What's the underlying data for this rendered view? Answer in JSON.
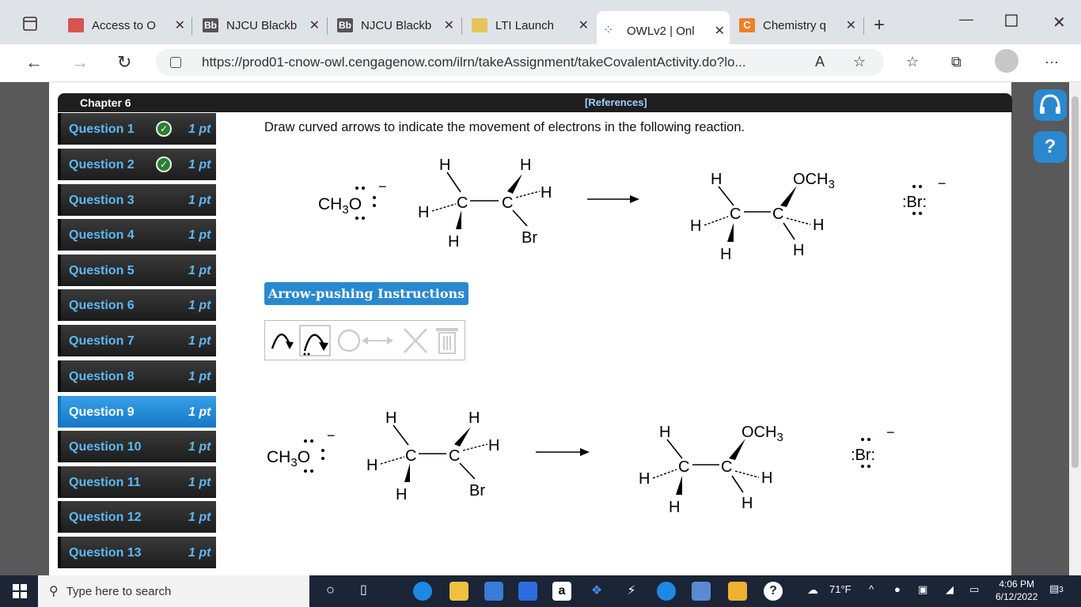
{
  "browser": {
    "tabs": [
      {
        "title": "Access to O",
        "icon": "access-favicon",
        "color": "#d9534f"
      },
      {
        "title": "NJCU Blackb",
        "icon": "blackboard-favicon",
        "color": "#555555"
      },
      {
        "title": "NJCU Blackb",
        "icon": "blackboard-favicon",
        "color": "#555555"
      },
      {
        "title": "LTI Launch",
        "icon": "pencil-favicon",
        "color": "#e6c35c"
      },
      {
        "title": "OWLv2 | Onl",
        "icon": "loading-favicon",
        "color": "#2a88cf"
      },
      {
        "title": "Chemistry q",
        "icon": "chegg-favicon",
        "color": "#f07f24"
      }
    ],
    "url": "https://prod01-cnow-owl.cengagenow.com/ilrn/takeAssignment/takeCovalentActivity.do?lo..."
  },
  "assignment": {
    "chapter": "Chapter 6",
    "references": "[References]",
    "questions": [
      {
        "label": "Question 1",
        "points": "1 pt",
        "done": true
      },
      {
        "label": "Question 2",
        "points": "1 pt",
        "done": true
      },
      {
        "label": "Question 3",
        "points": "1 pt",
        "done": false
      },
      {
        "label": "Question 4",
        "points": "1 pt",
        "done": false
      },
      {
        "label": "Question 5",
        "points": "1 pt",
        "done": false
      },
      {
        "label": "Question 6",
        "points": "1 pt",
        "done": false
      },
      {
        "label": "Question 7",
        "points": "1 pt",
        "done": false
      },
      {
        "label": "Question 8",
        "points": "1 pt",
        "done": false
      },
      {
        "label": "Question 9",
        "points": "1 pt",
        "done": false,
        "active": true
      },
      {
        "label": "Question 10",
        "points": "1 pt",
        "done": false
      },
      {
        "label": "Question 11",
        "points": "1 pt",
        "done": false
      },
      {
        "label": "Question 12",
        "points": "1 pt",
        "done": false
      },
      {
        "label": "Question 13",
        "points": "1 pt",
        "done": false
      }
    ],
    "instruction": "Draw curved arrows to indicate the movement of electrons in the following reaction.",
    "arrow_pushing_label": "Arrow-pushing Instructions",
    "chem": {
      "nucleophile": "CH3O",
      "charge": "−",
      "H": "H",
      "C": "C",
      "Br": "Br",
      "OCH3": "OCH3",
      "bromide": ":Br:"
    }
  },
  "taskbar": {
    "search_placeholder": "Type here to search",
    "weather": "71°F",
    "time": "4:06 PM",
    "date": "6/12/2022",
    "notifications": "3"
  }
}
